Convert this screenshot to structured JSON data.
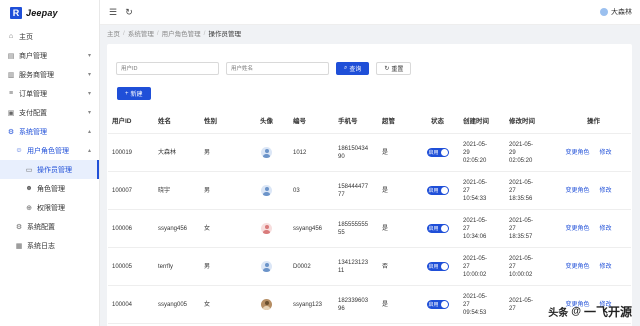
{
  "brand": {
    "logo_letter": "R",
    "name": "Jeepay"
  },
  "sidebar": {
    "items": [
      {
        "label": "主页",
        "icon": "home-icon",
        "glyph": "⌂"
      },
      {
        "label": "商户管理",
        "icon": "merchant-icon",
        "glyph": "▤",
        "arrow": "▾"
      },
      {
        "label": "服务商管理",
        "icon": "provider-icon",
        "glyph": "▥",
        "arrow": "▾"
      },
      {
        "label": "订单管理",
        "icon": "order-icon",
        "glyph": "≡",
        "arrow": "▾"
      },
      {
        "label": "支付配置",
        "icon": "payment-icon",
        "glyph": "▣",
        "arrow": "▾"
      },
      {
        "label": "系统管理",
        "icon": "system-icon",
        "glyph": "⚙",
        "arrow": "▴"
      },
      {
        "label": "用户角色管理",
        "icon": "user-role-icon",
        "glyph": "☺",
        "arrow": "▴"
      },
      {
        "label": "操作员管理",
        "icon": "operator-icon",
        "glyph": "▭"
      },
      {
        "label": "角色管理",
        "icon": "role-icon",
        "glyph": "☻"
      },
      {
        "label": "权限管理",
        "icon": "permission-icon",
        "glyph": "⊕"
      },
      {
        "label": "系统配置",
        "icon": "config-icon",
        "glyph": "⚙"
      },
      {
        "label": "系统日志",
        "icon": "log-icon",
        "glyph": "▦"
      }
    ]
  },
  "header": {
    "menu_glyph": "☰",
    "refresh_glyph": "↻",
    "user_name": "大森林"
  },
  "breadcrumb": [
    "主页",
    "系统管理",
    "用户角色管理",
    "操作员管理"
  ],
  "filters": {
    "user_id_placeholder": "用户ID",
    "user_name_placeholder": "用户姓名",
    "query_label": "查询",
    "reset_label": "重置",
    "add_label": "新建"
  },
  "table": {
    "headers": [
      "用户ID",
      "姓名",
      "性别",
      "头像",
      "编号",
      "手机号",
      "超管",
      "状态",
      "创建时间",
      "修改时间",
      "操作"
    ],
    "rows": [
      {
        "id": "100019",
        "name": "大森林",
        "gender": "男",
        "avatar": "male",
        "code": "1012",
        "phone": "186150434\n90",
        "admin": "是",
        "status": "启用",
        "created": "2021-05-\n29\n02:05:20",
        "modified": "2021-05-\n29\n02:05:20"
      },
      {
        "id": "100007",
        "name": "晓宇",
        "gender": "男",
        "avatar": "male",
        "code": "03",
        "phone": "158444477\n77",
        "admin": "是",
        "status": "启用",
        "created": "2021-05-\n27\n10:54:33",
        "modified": "2021-05-\n27\n18:35:56"
      },
      {
        "id": "100006",
        "name": "ssyang456",
        "gender": "女",
        "avatar": "female",
        "code": "ssyang456",
        "phone": "185555555\n55",
        "admin": "是",
        "status": "启用",
        "created": "2021-05-\n27\n10:34:06",
        "modified": "2021-05-\n27\n18:35:57"
      },
      {
        "id": "100005",
        "name": "terrfly",
        "gender": "男",
        "avatar": "male",
        "code": "D0002",
        "phone": "134123123\n11",
        "admin": "否",
        "status": "启用",
        "created": "2021-05-\n27\n10:00:02",
        "modified": "2021-05-\n27\n10:00:02"
      },
      {
        "id": "100004",
        "name": "ssyang005",
        "gender": "女",
        "avatar": "photo",
        "code": "ssyang123",
        "phone": "182339603\n96",
        "admin": "是",
        "status": "启用",
        "created": "2021-05-\n27\n09:54:53",
        "modified": "2021-05-\n27\n"
      }
    ],
    "action_change_role": "变更角色",
    "action_edit": "修改"
  },
  "watermark": {
    "text": "头条",
    "at": "@",
    "author": "一飞开源"
  },
  "colors": {
    "accent": "#1f4fd8",
    "active_bg": "#e8effd"
  }
}
